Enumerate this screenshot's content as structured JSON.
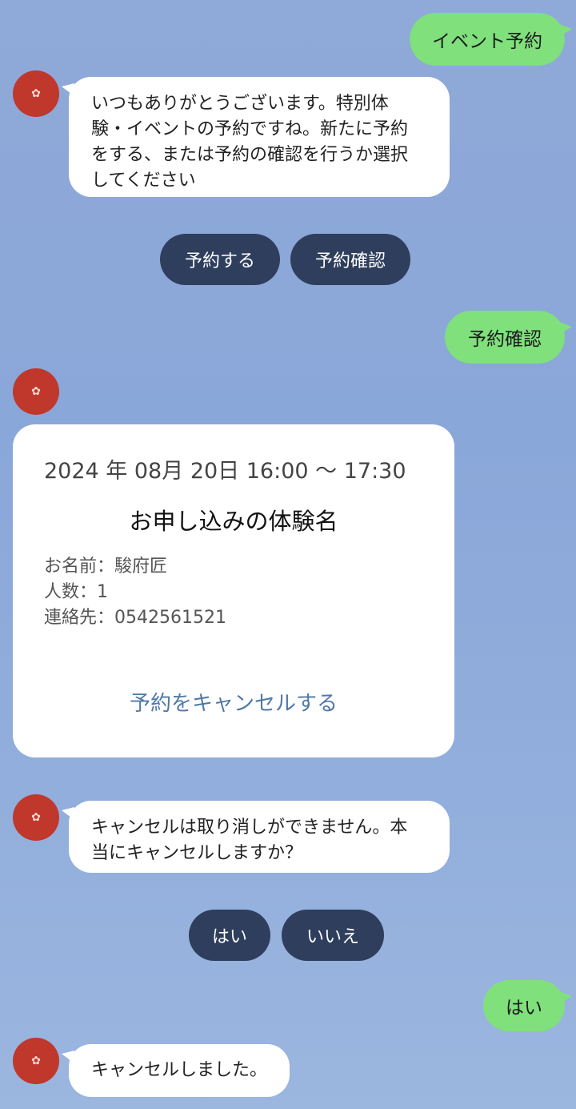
{
  "bot": {
    "avatar_icon": "shop-logo-icon",
    "avatar_color": "#c0372b"
  },
  "messages": {
    "user_event_reservation": "イベント予約",
    "bot_greeting_lines": [
      "いつもありがとうございます。特別体",
      "験・イベントの予約ですね。新たに予約",
      "をする、または予約の確認を行うか選択",
      "してください"
    ],
    "user_check_reservation": "予約確認",
    "bot_cancel_warning_lines": [
      "キャンセルは取り消しができません。本",
      "当にキャンセルしますか？"
    ],
    "user_yes": "はい",
    "bot_cancelled": "キャンセルしました。"
  },
  "quick_replies_1": {
    "make_reservation": "予約する",
    "check_reservation": "予約確認"
  },
  "reservation_card": {
    "datetime": "2024 年 08月 20日 16:00 ～ 17:30",
    "experience_name": "お申し込みの体験名",
    "name_line": "お名前：駿府匠",
    "people_line": "人数：1",
    "contact_line": "連絡先：0542561521",
    "cancel_action": "予約をキャンセルする"
  },
  "quick_replies_2": {
    "yes": "はい",
    "no": "いいえ"
  },
  "colors": {
    "user_bubble": "#7fe07c",
    "bot_bubble": "#ffffff",
    "quick_reply": "#2e3e5c",
    "link": "#4f79a6",
    "background": "#8fa9d8"
  }
}
